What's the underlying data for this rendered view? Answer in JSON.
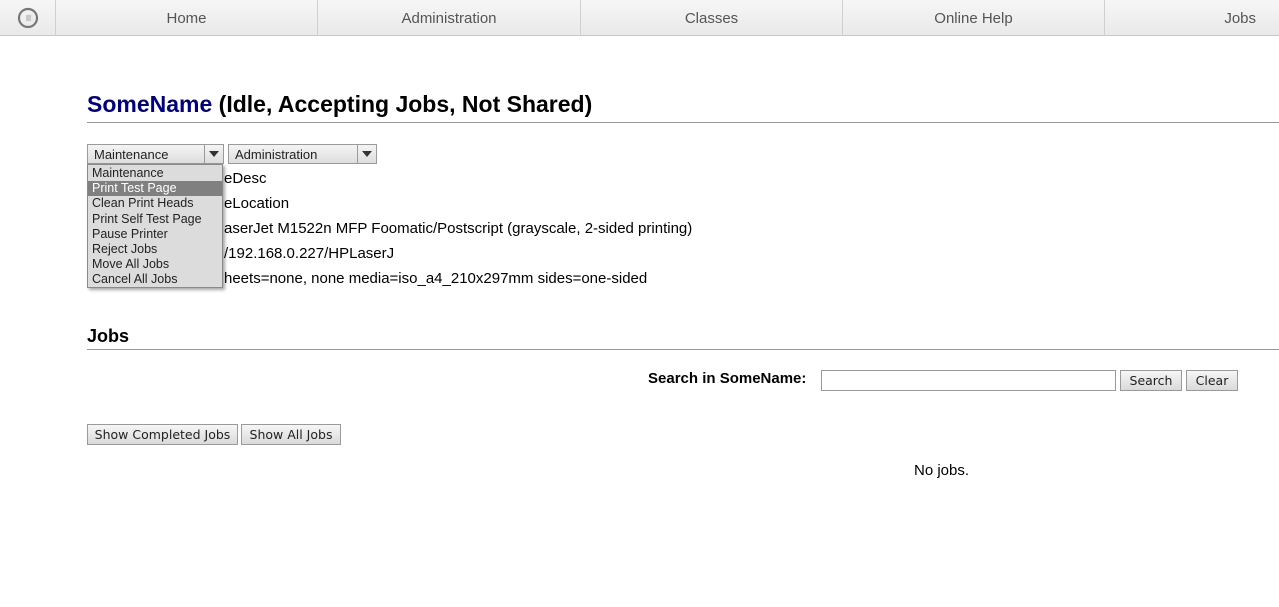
{
  "nav": {
    "items": [
      "Home",
      "Administration",
      "Classes",
      "Online Help",
      "Jobs"
    ]
  },
  "printer": {
    "name": "SomeName",
    "status": " (Idle, Accepting Jobs, Not Shared)"
  },
  "maintenance_select": {
    "selected": "Maintenance",
    "options": [
      "Maintenance",
      "Print Test Page",
      "Clean Print Heads",
      "Print Self Test Page",
      "Pause Printer",
      "Reject Jobs",
      "Move All Jobs",
      "Cancel All Jobs"
    ],
    "highlighted": "Print Test Page"
  },
  "administration_select": {
    "selected": "Administration"
  },
  "info_lines": [
    "eDesc",
    "eLocation",
    "aserJet M1522n MFP Foomatic/Postscript (grayscale, 2-sided printing)",
    "/192.168.0.227/HPLaserJ",
    "heets=none, none media=iso_a4_210x297mm sides=one-sided"
  ],
  "jobs": {
    "title": "Jobs",
    "search_label": "Search in SomeName:",
    "search_value": "",
    "search_button": "Search",
    "clear_button": "Clear",
    "show_completed_button": "Show Completed Jobs",
    "show_all_button": "Show All Jobs",
    "empty_message": "No jobs."
  }
}
